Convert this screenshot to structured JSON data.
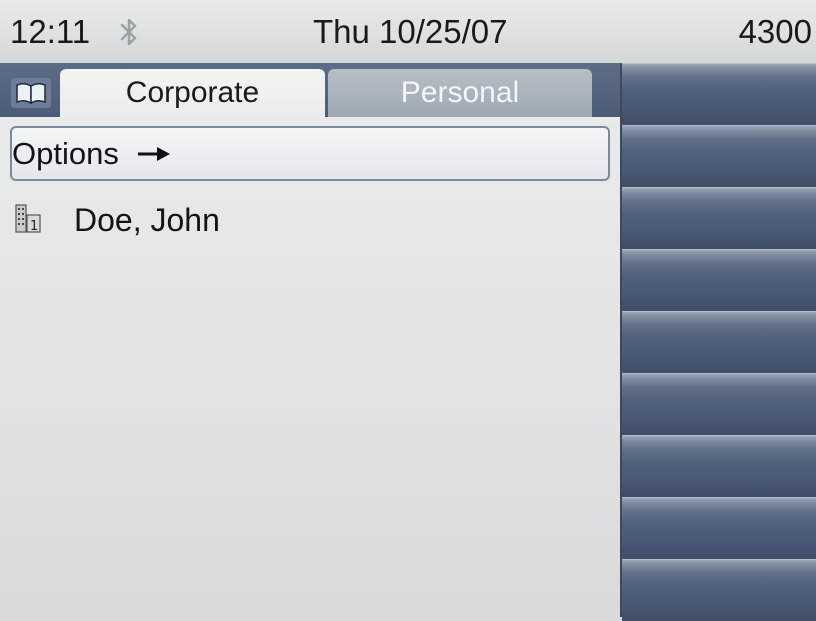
{
  "status_bar": {
    "time": "12:11",
    "date": "Thu 10/25/07",
    "extension": "4300",
    "icons": [
      "bluetooth-icon"
    ]
  },
  "tabs": [
    {
      "label": "Corporate",
      "active": true
    },
    {
      "label": "Personal",
      "active": false
    }
  ],
  "tab_icon": "phonebook-icon",
  "options": {
    "label": "Options",
    "arrow_icon": "right-arrow-icon"
  },
  "entries": [
    {
      "name": "Doe, John",
      "icon": "building-icon"
    }
  ],
  "softkeys": [
    "",
    "",
    "",
    "",
    "",
    "",
    "",
    "",
    ""
  ],
  "colors": {
    "tab_strip": "#4c5b76",
    "active_tab": "#eef0ef",
    "inactive_tab": "#a9b3bd",
    "softkey_panel": "#485873",
    "options_border": "#7b8aa1"
  }
}
